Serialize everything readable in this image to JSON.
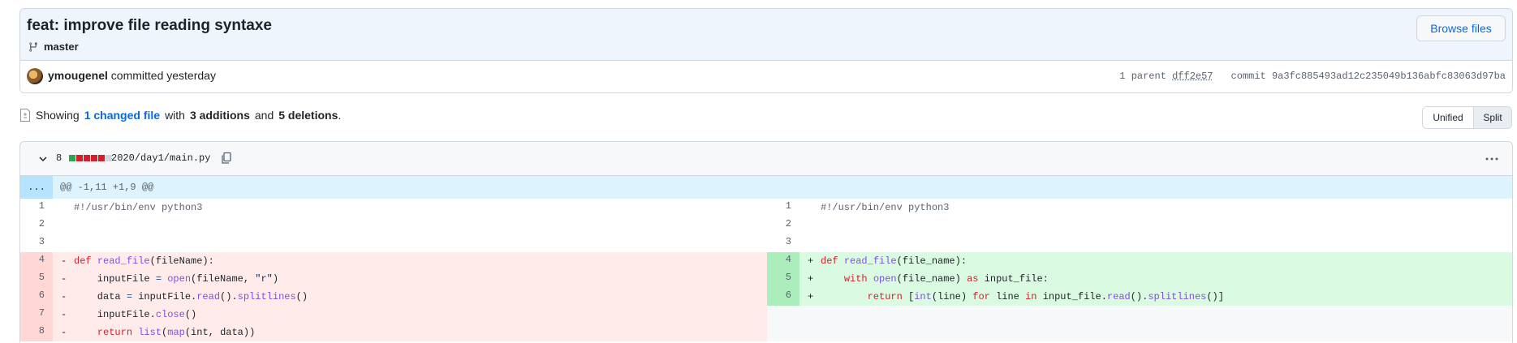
{
  "commit": {
    "title": "feat: improve file reading syntaxe",
    "branch": "master",
    "browse_label": "Browse files",
    "author": "ymougenel",
    "action": "committed yesterday",
    "parent_label": "1 parent",
    "parent_sha": "dff2e57",
    "commit_label": "commit",
    "commit_sha": "9a3fc885493ad12c235049b136abfc83063d97ba"
  },
  "summary": {
    "showing": "Showing",
    "changed_files": "1 changed file",
    "with": "with",
    "additions": "3 additions",
    "and": "and",
    "deletions": "5 deletions",
    "period": "."
  },
  "view_toggle": {
    "unified": "Unified",
    "split": "Split",
    "selected": "Split"
  },
  "file": {
    "changes_count": "8",
    "path": "2020/day1/main.py",
    "diffstat": [
      "add",
      "del",
      "del",
      "del",
      "del",
      "neutral"
    ],
    "hunk_expand": "...",
    "hunk_header": "@@ -1,11 +1,9 @@",
    "left_lines": [
      {
        "num": "1",
        "type": "ctx",
        "marker": "",
        "code": "#!/usr/bin/env python3"
      },
      {
        "num": "2",
        "type": "ctx",
        "marker": "",
        "code": ""
      },
      {
        "num": "3",
        "type": "ctx",
        "marker": "",
        "code": ""
      },
      {
        "num": "4",
        "type": "del",
        "marker": "-",
        "code": "def read_file(fileName):"
      },
      {
        "num": "5",
        "type": "del",
        "marker": "-",
        "code": "    inputFile = open(fileName, \"r\")"
      },
      {
        "num": "6",
        "type": "del",
        "marker": "-",
        "code": "    data = inputFile.read().splitlines()"
      },
      {
        "num": "7",
        "type": "del",
        "marker": "-",
        "code": "    inputFile.close()"
      },
      {
        "num": "8",
        "type": "del",
        "marker": "-",
        "code": "    return list(map(int, data))"
      }
    ],
    "right_lines": [
      {
        "num": "1",
        "type": "ctx",
        "marker": "",
        "code": "#!/usr/bin/env python3"
      },
      {
        "num": "2",
        "type": "ctx",
        "marker": "",
        "code": ""
      },
      {
        "num": "3",
        "type": "ctx",
        "marker": "",
        "code": ""
      },
      {
        "num": "4",
        "type": "add",
        "marker": "+",
        "code": "def read_file(file_name):"
      },
      {
        "num": "5",
        "type": "add",
        "marker": "+",
        "code": "    with open(file_name) as input_file:"
      },
      {
        "num": "6",
        "type": "add",
        "marker": "+",
        "code": "        return [int(line) for line in input_file.read().splitlines()]"
      },
      {
        "num": "",
        "type": "empty",
        "marker": "",
        "code": ""
      },
      {
        "num": "",
        "type": "empty",
        "marker": "",
        "code": ""
      }
    ]
  },
  "colors": {
    "accent_link": "#0969da",
    "add_bg": "#dafbe1",
    "del_bg": "#ffebe9",
    "hunk_bg": "#ddf4ff"
  }
}
